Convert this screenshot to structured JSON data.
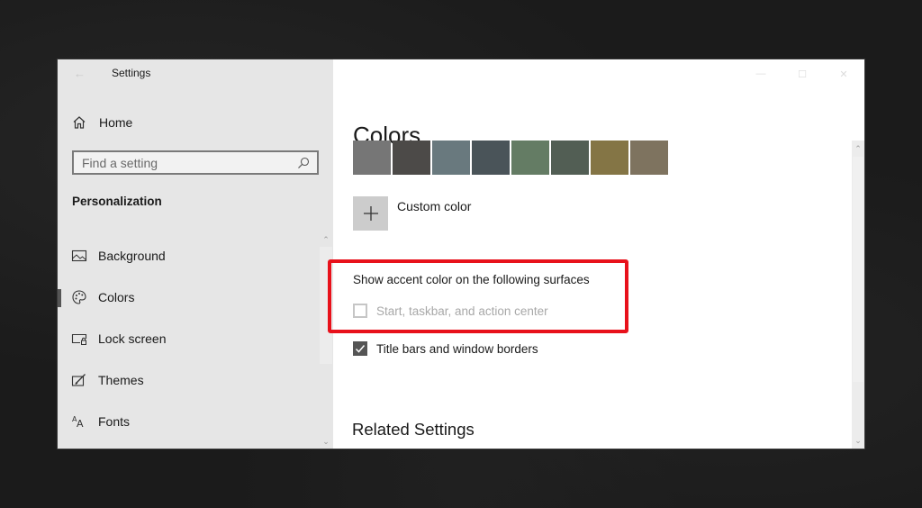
{
  "window": {
    "title": "Settings",
    "controls": {
      "minimize": "—",
      "maximize": "☐",
      "close": "✕"
    },
    "back_icon": "←"
  },
  "sidebar": {
    "home_label": "Home",
    "search": {
      "placeholder": "Find a setting",
      "value": ""
    },
    "section_title": "Personalization",
    "items": [
      {
        "label": "Background",
        "icon": "background-image-icon",
        "active": false
      },
      {
        "label": "Colors",
        "icon": "palette-icon",
        "active": true
      },
      {
        "label": "Lock screen",
        "icon": "lock-screen-icon",
        "active": false
      },
      {
        "label": "Themes",
        "icon": "themes-icon",
        "active": false
      },
      {
        "label": "Fonts",
        "icon": "fonts-icon",
        "active": false
      }
    ],
    "scroll_up": "⌃",
    "scroll_down": "⌄"
  },
  "main": {
    "page_title": "Colors",
    "swatches": [
      "#767676",
      "#4c4a48",
      "#69797e",
      "#4a5459",
      "#647c64",
      "#525e54",
      "#847545",
      "#7e735f"
    ],
    "custom_color_label": "Custom color",
    "custom_color_icon": "+",
    "surfaces_label": "Show accent color on the following surfaces",
    "checkboxes": [
      {
        "label": "Start, taskbar, and action center",
        "checked": false,
        "disabled": true
      },
      {
        "label": "Title bars and window borders",
        "checked": true,
        "disabled": false
      }
    ],
    "related_title": "Related Settings",
    "highlight_color": "#e8111b"
  }
}
